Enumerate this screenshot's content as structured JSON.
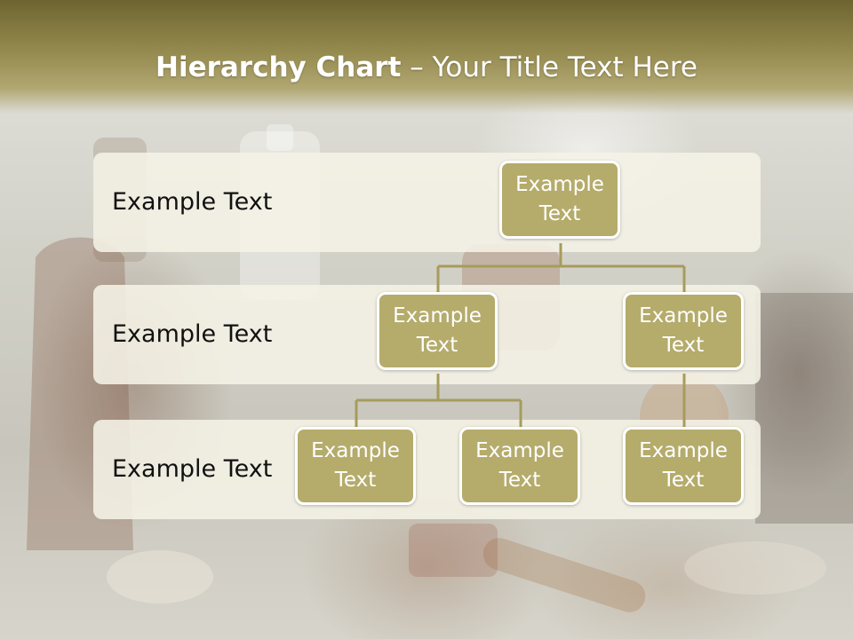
{
  "title": {
    "bold": "Hierarchy Chart",
    "rest": " – Your Title Text Here"
  },
  "levels": [
    {
      "label": "Example Text"
    },
    {
      "label": "Example Text"
    },
    {
      "label": "Example Text"
    }
  ],
  "nodes": {
    "root": "Example\nText",
    "mid_left": "Example\nText",
    "mid_right": "Example\nText",
    "leaf_1": "Example\nText",
    "leaf_2": "Example\nText",
    "leaf_3": "Example\nText"
  },
  "colors": {
    "header": "#948a4e",
    "node_fill": "#b5ab6b",
    "node_border": "#ffffff",
    "connector": "#a69c5c",
    "band": "#f5f3e6"
  }
}
